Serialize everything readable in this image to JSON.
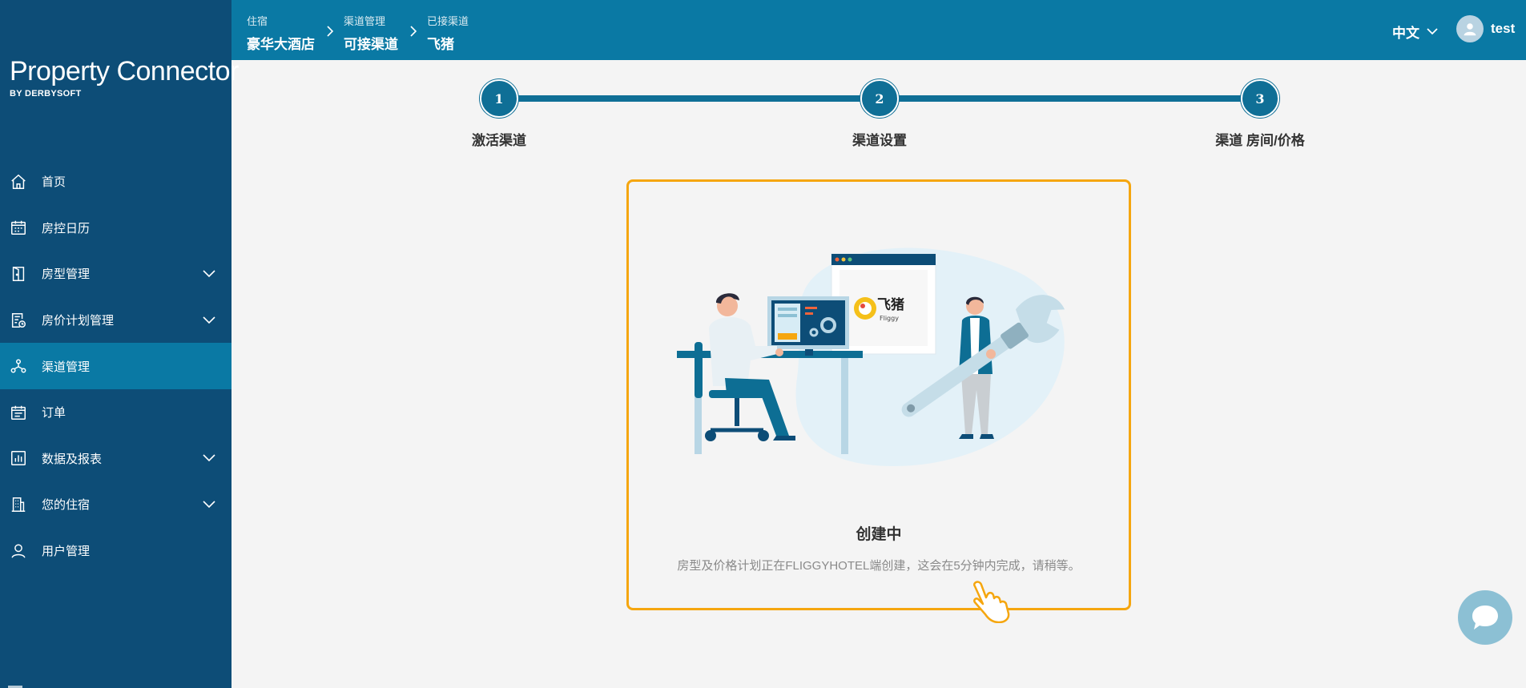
{
  "sidebar": {
    "logo_title": "Property Connector",
    "logo_sub": "BY DERBYSOFT",
    "items": [
      {
        "label": "首页",
        "icon": "home-icon",
        "has_children": false,
        "active": false
      },
      {
        "label": "房控日历",
        "icon": "calendar-icon",
        "has_children": false,
        "active": false
      },
      {
        "label": "房型管理",
        "icon": "door-icon",
        "has_children": true,
        "active": false
      },
      {
        "label": "房价计划管理",
        "icon": "rate-plan-icon",
        "has_children": true,
        "active": false
      },
      {
        "label": "渠道管理",
        "icon": "channel-icon",
        "has_children": false,
        "active": true
      },
      {
        "label": "订单",
        "icon": "order-icon",
        "has_children": false,
        "active": false
      },
      {
        "label": "数据及报表",
        "icon": "report-icon",
        "has_children": true,
        "active": false
      },
      {
        "label": "您的住宿",
        "icon": "building-icon",
        "has_children": true,
        "active": false
      },
      {
        "label": "用户管理",
        "icon": "user-icon",
        "has_children": false,
        "active": false
      }
    ]
  },
  "breadcrumb": [
    {
      "small": "住宿",
      "big": "豪华大酒店"
    },
    {
      "small": "渠道管理",
      "big": "可接渠道"
    },
    {
      "small": "已接渠道",
      "big": "飞猪"
    }
  ],
  "header": {
    "language": "中文",
    "username": "test"
  },
  "steps": [
    {
      "number": "1",
      "label": "激活渠道"
    },
    {
      "number": "2",
      "label": "渠道设置"
    },
    {
      "number": "3",
      "label": "渠道 房间/价格"
    }
  ],
  "status_card": {
    "title": "创建中",
    "description": "房型及价格计划正在FLIGGYHOTEL端创建，这会在5分钟内完成，请稍等。",
    "channel_logo_text": "飞猪",
    "channel_logo_sub": "Fliggy"
  },
  "colors": {
    "sidebar_bg": "#0d4d77",
    "topbar_bg": "#0a79a4",
    "active_nav": "#0a79a4",
    "step_color": "#0f6f96",
    "card_border": "#f5a60f"
  }
}
